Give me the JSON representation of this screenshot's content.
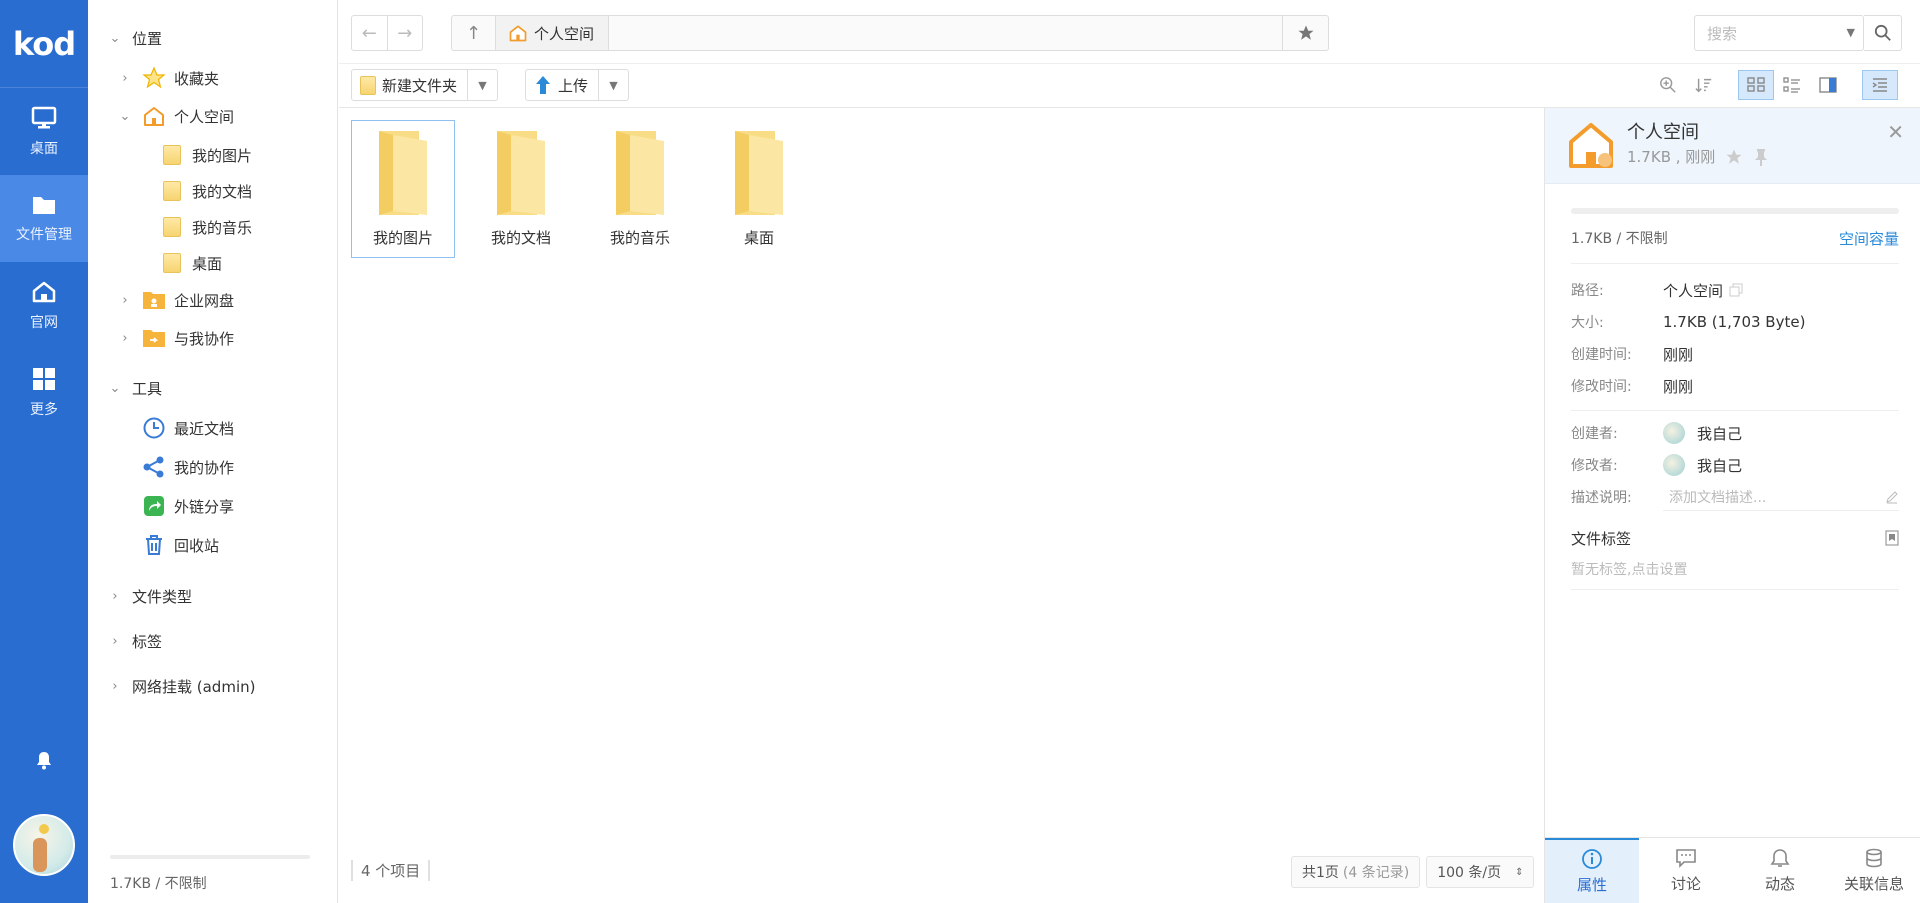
{
  "brand": {
    "logo": "kod"
  },
  "rail": {
    "items": [
      {
        "label": "桌面",
        "icon": "monitor-icon"
      },
      {
        "label": "文件管理",
        "icon": "folder-icon",
        "active": true
      },
      {
        "label": "官网",
        "icon": "home-icon"
      },
      {
        "label": "更多",
        "icon": "grid-icon"
      }
    ],
    "bell_icon": "bell-icon"
  },
  "tree": {
    "sections": {
      "location": "位置",
      "favorites": "收藏夹",
      "personal": "个人空间",
      "my_pictures": "我的图片",
      "my_docs": "我的文档",
      "my_music": "我的音乐",
      "desktop": "桌面",
      "enterprise": "企业网盘",
      "shared_with_me": "与我协作",
      "tools": "工具",
      "recent": "最近文档",
      "my_collab": "我的协作",
      "external_share": "外链分享",
      "recycle": "回收站",
      "file_types": "文件类型",
      "tags": "标签",
      "network_mount": "网络挂载 (admin)"
    },
    "footer_quota": "1.7KB / 不限制"
  },
  "topbar": {
    "breadcrumb": "个人空间",
    "search_placeholder": "搜索"
  },
  "toolbar": {
    "new_folder": "新建文件夹",
    "upload": "上传"
  },
  "content": {
    "items": [
      {
        "name": "我的图片",
        "selected": true
      },
      {
        "name": "我的文档"
      },
      {
        "name": "我的音乐"
      },
      {
        "name": "桌面"
      }
    ],
    "status": "4 个项目",
    "pager": {
      "pages": "共1页",
      "records": "(4 条记录)",
      "per_page": "100 条/页"
    }
  },
  "panel": {
    "title": "个人空间",
    "subtitle": "1.7KB , 刚刚",
    "quota": "1.7KB / 不限制",
    "quota_link": "空间容量",
    "rows": {
      "path_k": "路径:",
      "path_v": "个人空间",
      "size_k": "大小:",
      "size_v": "1.7KB (1,703 Byte)",
      "created_k": "创建时间:",
      "created_v": "刚刚",
      "modified_k": "修改时间:",
      "modified_v": "刚刚",
      "creator_k": "创建者:",
      "creator_v": "我自己",
      "modifier_k": "修改者:",
      "modifier_v": "我自己",
      "desc_k": "描述说明:",
      "desc_placeholder": "添加文档描述..."
    },
    "tags_title": "文件标签",
    "tags_empty": "暂无标签,点击设置",
    "tabs": [
      {
        "label": "属性",
        "active": true
      },
      {
        "label": "讨论"
      },
      {
        "label": "动态"
      },
      {
        "label": "关联信息"
      }
    ]
  },
  "colors": {
    "brand": "#2a6dd1",
    "accent": "#2a8ad8",
    "folder": "#f7d471"
  }
}
